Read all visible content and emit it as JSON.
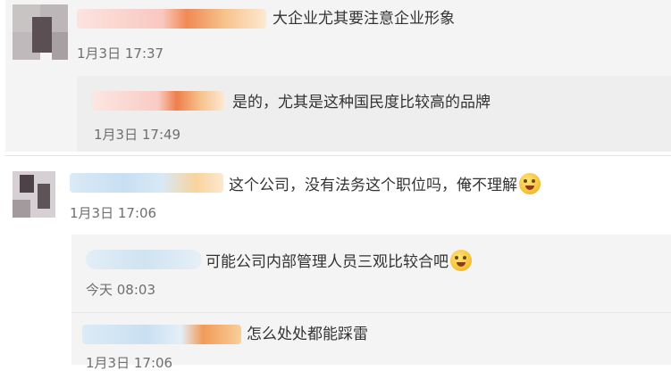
{
  "comments": [
    {
      "id": "c1",
      "text": "大企业尤其要注意企业形象",
      "timestamp": "1月3日 17:37",
      "has_emoji": false
    },
    {
      "id": "c2",
      "text": "是的，尤其是这种国民度比较高的品牌",
      "timestamp": "1月3日 17:49",
      "has_emoji": false
    },
    {
      "id": "c3",
      "text": "这个公司，没有法务这个职位吗，俺不理解",
      "timestamp": "1月3日 17:06",
      "has_emoji": true,
      "emoji_icon": "fearful-face-icon"
    },
    {
      "id": "c4",
      "text": "可能公司内部管理人员三观比较合吧",
      "timestamp": "今天 08:03",
      "has_emoji": true,
      "emoji_icon": "crying-laughing-face-icon"
    },
    {
      "id": "c5",
      "text": "怎么处处都能踩雷",
      "timestamp": "1月3日 17:06",
      "has_emoji": false
    }
  ],
  "colors": {
    "background": "#ffffff",
    "reply_block": "#f4f4f4",
    "timestamp": "#6f6f6f",
    "text": "#333333"
  }
}
